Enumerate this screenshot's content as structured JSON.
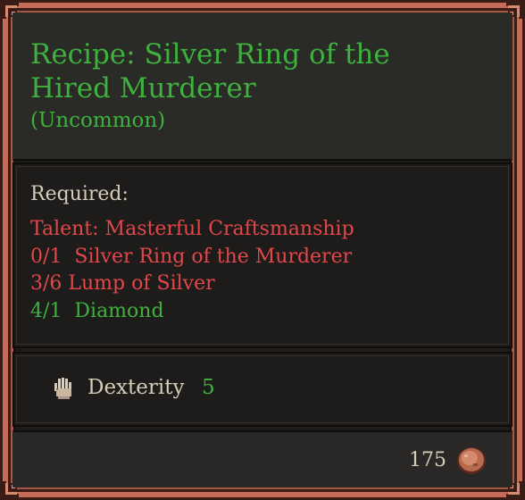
{
  "item": {
    "title": "Recipe: Silver Ring of the Hired Murderer",
    "rarity": "(Uncommon)",
    "colors": {
      "frame": "#c46c57",
      "panel": "#1e1c1b",
      "good": "#3fb13f",
      "bad": "#e2474a",
      "text": "#d6ccb8"
    }
  },
  "requirements": {
    "label": "Required:",
    "items": [
      {
        "text": "Talent: Masterful Craftsmanship",
        "status": "missing"
      },
      {
        "text": "0/1  Silver Ring of the Murderer",
        "status": "missing"
      },
      {
        "text": "3/6 Lump of Silver",
        "status": "missing"
      },
      {
        "text": "4/1  Diamond",
        "status": "met"
      }
    ]
  },
  "stat": {
    "icon": "hand-icon",
    "name": "Dexterity",
    "value": "5"
  },
  "price": {
    "value": "175",
    "icon": "copper-coin-icon"
  }
}
